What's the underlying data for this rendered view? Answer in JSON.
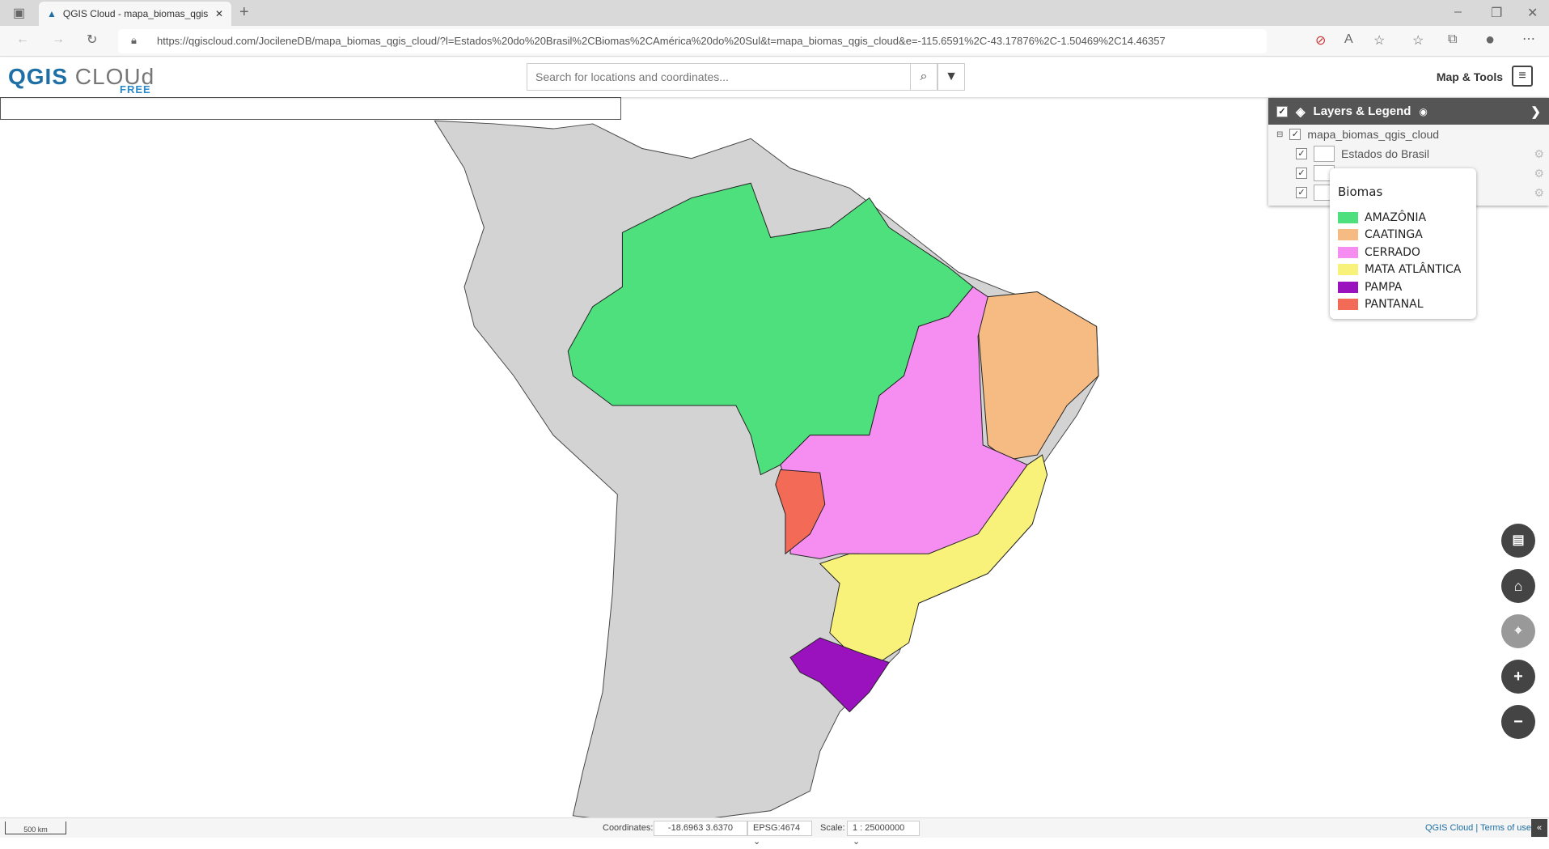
{
  "browser": {
    "tab_title": "QGIS Cloud - mapa_biomas_qgis",
    "url": "https://qgiscloud.com/JocileneDB/mapa_biomas_qgis_cloud/?l=Estados%20do%20Brasil%2CBiomas%2CAmérica%20do%20Sul&t=mapa_biomas_qgis_cloud&e=-115.6591%2C-43.17876%2C-1.50469%2C14.46357"
  },
  "header": {
    "logo_main": "QGIS",
    "logo_cloud": "CLOUd",
    "logo_sub": "FREE",
    "search_placeholder": "Search for locations and coordinates...",
    "map_tools": "Map & Tools"
  },
  "layers": {
    "title": "Layers & Legend",
    "project": "mapa_biomas_qgis_cloud",
    "items": [
      {
        "label": "Estados do Brasil"
      },
      {
        "label": ""
      },
      {
        "label": ""
      }
    ]
  },
  "legend": {
    "title": "Biomas",
    "items": [
      {
        "label": "AMAZÔNIA",
        "color": "#4ee07d"
      },
      {
        "label": "CAATINGA",
        "color": "#f5bb82"
      },
      {
        "label": "CERRADO",
        "color": "#f58ef0"
      },
      {
        "label": "MATA ATLÂNTICA",
        "color": "#f8f27a"
      },
      {
        "label": "PAMPA",
        "color": "#9a12be"
      },
      {
        "label": "PANTANAL",
        "color": "#f36a57"
      }
    ]
  },
  "bottom": {
    "scale_bar": "500 km",
    "coordinates_label": "Coordinates:",
    "coordinates": "-18.6963 3.6370",
    "crs": "EPSG:4674",
    "scale_label": "Scale:",
    "scale": "1 : 25000000",
    "credits": "QGIS Cloud | Terms of use"
  }
}
